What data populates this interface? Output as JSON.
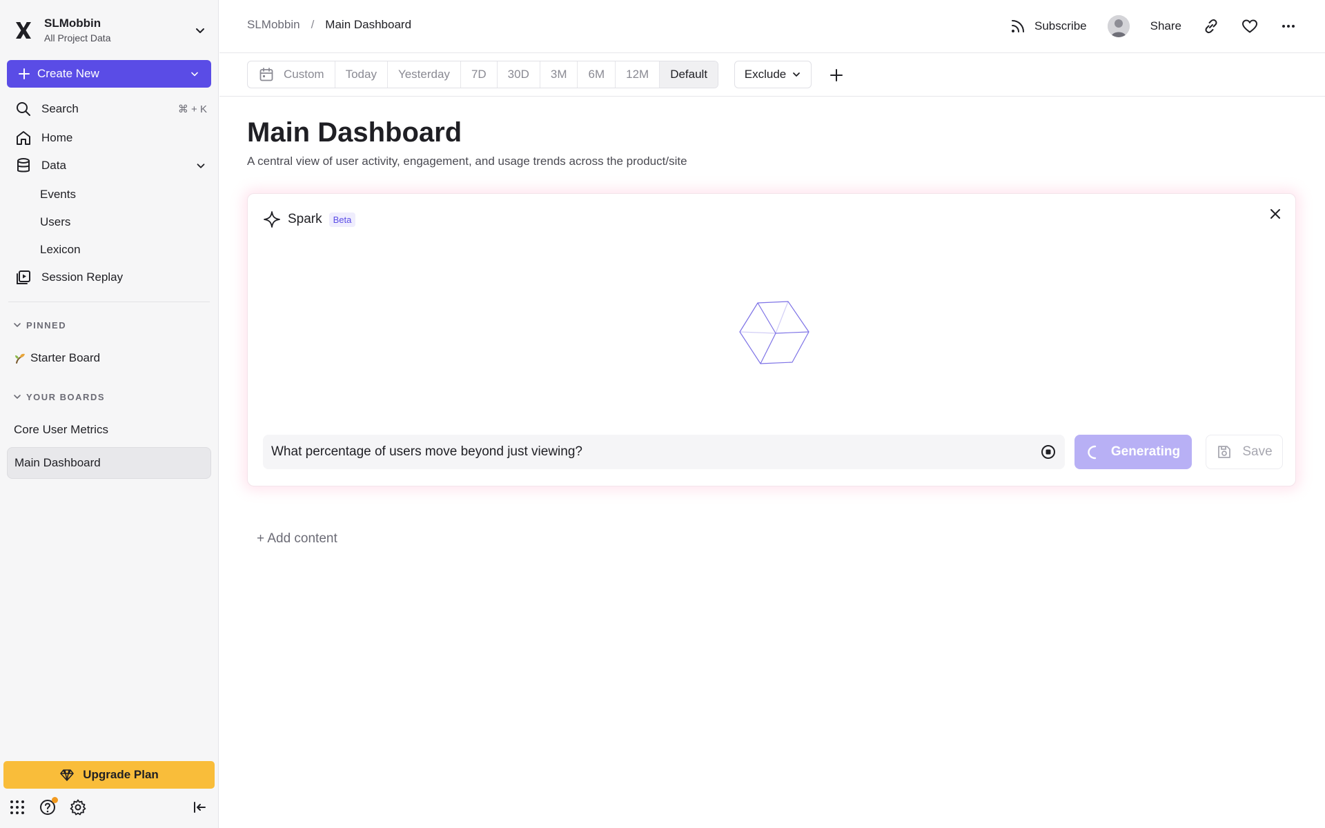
{
  "sidebar": {
    "workspace_name": "SLMobbin",
    "workspace_sub": "All Project Data",
    "create_label": "Create New",
    "search_label": "Search",
    "search_shortcut": "⌘ + K",
    "home_label": "Home",
    "data_label": "Data",
    "data_children": [
      "Events",
      "Users",
      "Lexicon"
    ],
    "session_replay_label": "Session Replay",
    "pinned_heading": "PINNED",
    "pinned_items": [
      "Starter Board"
    ],
    "boards_heading": "YOUR BOARDS",
    "boards": [
      "Core User Metrics",
      "Main Dashboard"
    ],
    "upgrade_label": "Upgrade Plan"
  },
  "header": {
    "breadcrumb_root": "SLMobbin",
    "breadcrumb_sep": "/",
    "breadcrumb_current": "Main Dashboard",
    "subscribe_label": "Subscribe",
    "share_label": "Share"
  },
  "toolbar": {
    "date_ranges": [
      "Custom",
      "Today",
      "Yesterday",
      "7D",
      "30D",
      "3M",
      "6M",
      "12M",
      "Default"
    ],
    "active_range": "Default",
    "exclude_label": "Exclude"
  },
  "main": {
    "title": "Main Dashboard",
    "description": "A central view of user activity, engagement, and usage trends across the product/site",
    "add_content_label": "+ Add content"
  },
  "spark": {
    "title": "Spark",
    "badge": "Beta",
    "prompt_value": "What percentage of users move beyond just viewing?",
    "generating_label": "Generating",
    "save_label": "Save"
  },
  "colors": {
    "accent": "#5a4ce6",
    "accent_disabled": "#b8b0f5",
    "upgrade": "#f9bd3a",
    "notification": "#f29a1f"
  }
}
